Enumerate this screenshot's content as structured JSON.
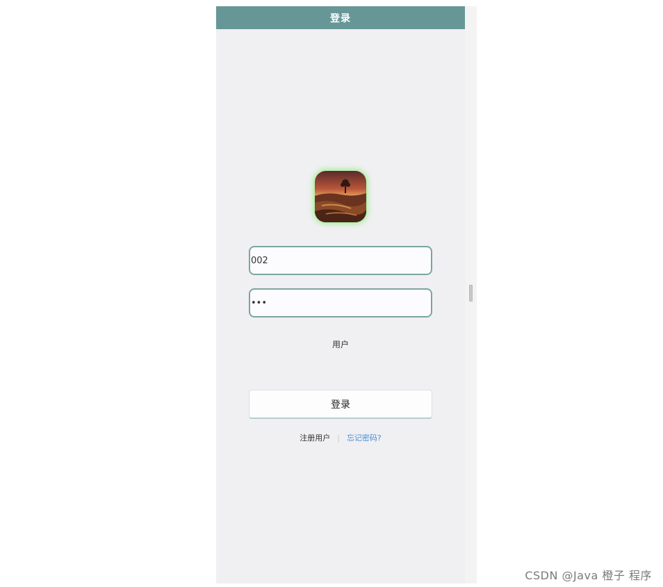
{
  "header": {
    "title": "登录"
  },
  "login_form": {
    "username_value": "002",
    "password_mask": "•••",
    "role_label": "用户",
    "submit_label": "登录"
  },
  "links": {
    "register": "注册用户",
    "separator": "|",
    "forgot": "忘记密码?"
  },
  "watermark": "CSDN @Java  橙子  程序",
  "colors": {
    "header_bg": "#669796",
    "field_border": "#7aa59f",
    "link_blue": "#4b8fd4",
    "avatar_glow": "#a8f0a0"
  },
  "icons": {
    "avatar": "landscape-avatar-image"
  }
}
